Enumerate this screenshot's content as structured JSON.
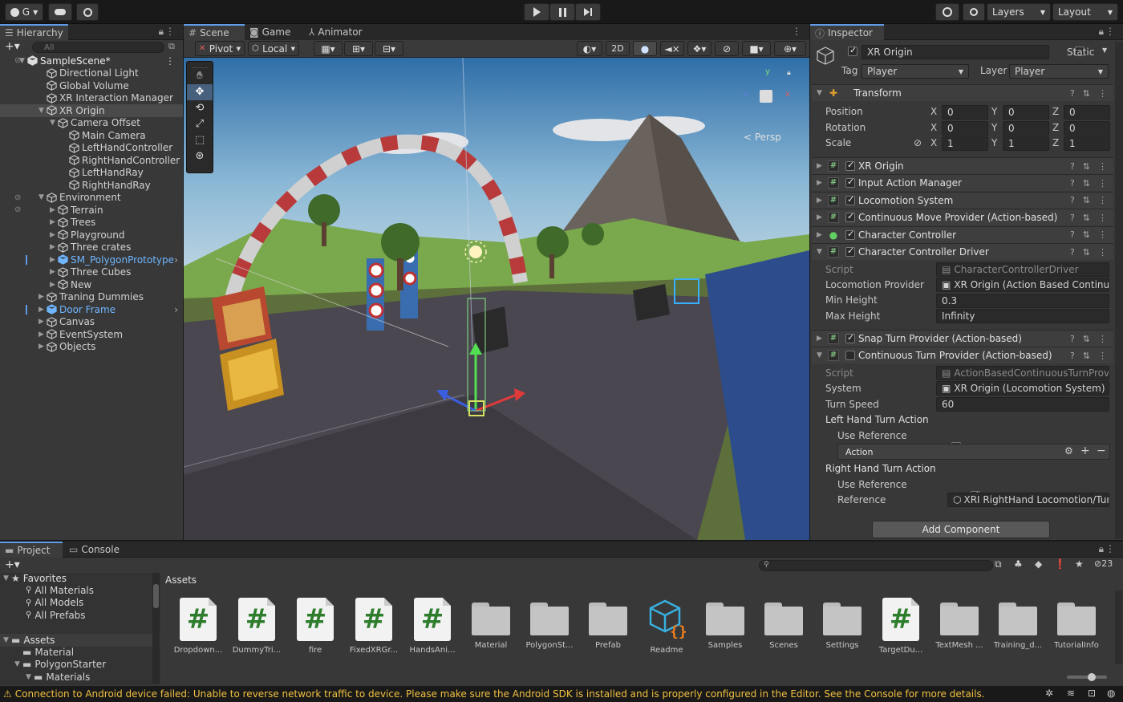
{
  "toolbar": {
    "account": "G",
    "layers_label": "Layers",
    "layout_label": "Layout"
  },
  "hierarchy": {
    "tab": "Hierarchy",
    "search_placeholder": "All",
    "items": [
      {
        "label": "SampleScene*",
        "depth": 0
      },
      {
        "label": "Directional Light",
        "depth": 1
      },
      {
        "label": "Global Volume",
        "depth": 1
      },
      {
        "label": "XR Interaction Manager",
        "depth": 1
      },
      {
        "label": "XR Origin",
        "depth": 1
      },
      {
        "label": "Camera Offset",
        "depth": 2
      },
      {
        "label": "Main Camera",
        "depth": 3
      },
      {
        "label": "LeftHandController",
        "depth": 3
      },
      {
        "label": "RightHandController",
        "depth": 3
      },
      {
        "label": "LeftHandRay",
        "depth": 3
      },
      {
        "label": "RightHandRay",
        "depth": 3
      },
      {
        "label": "Environment",
        "depth": 1
      },
      {
        "label": "Terrain",
        "depth": 2
      },
      {
        "label": "Trees",
        "depth": 2
      },
      {
        "label": "Playground",
        "depth": 2
      },
      {
        "label": "Three crates",
        "depth": 2
      },
      {
        "label": "SM_PolygonPrototype",
        "depth": 2
      },
      {
        "label": "Three Cubes",
        "depth": 2
      },
      {
        "label": "New",
        "depth": 2
      },
      {
        "label": "Traning Dummies",
        "depth": 1
      },
      {
        "label": "Door Frame",
        "depth": 1
      },
      {
        "label": "Canvas",
        "depth": 1
      },
      {
        "label": "EventSystem",
        "depth": 1
      },
      {
        "label": "Objects",
        "depth": 1
      }
    ]
  },
  "scene": {
    "tabs": [
      "Scene",
      "Game",
      "Animator"
    ],
    "pivot": "Pivot",
    "local": "Local",
    "mode_2d": "2D",
    "persp": "< Persp",
    "gizmo_x": "x",
    "gizmo_y": "y",
    "gizmo_z": "z"
  },
  "inspector": {
    "tab": "Inspector",
    "object_name": "XR Origin",
    "static_label": "Static",
    "tag_label": "Tag",
    "tag_value": "Player",
    "layer_label": "Layer",
    "layer_value": "Player",
    "transform": {
      "title": "Transform",
      "rows": [
        {
          "label": "Position",
          "x": "0",
          "y": "0",
          "z": "0"
        },
        {
          "label": "Rotation",
          "x": "0",
          "y": "0",
          "z": "0"
        },
        {
          "label": "Scale",
          "x": "1",
          "y": "1",
          "z": "1"
        }
      ],
      "axis_x": "X",
      "axis_y": "Y",
      "axis_z": "Z"
    },
    "components": [
      "XR Origin",
      "Input Action Manager",
      "Locomotion System",
      "Continuous Move Provider (Action-based)",
      "Character Controller",
      "Character Controller Driver"
    ],
    "ccd": {
      "script_label": "Script",
      "script_value": "CharacterControllerDriver",
      "locomotion_label": "Locomotion Provider",
      "locomotion_value": "XR Origin  (Action Based Continu",
      "min_label": "Min Height",
      "min_value": "0.3",
      "max_label": "Max Height",
      "max_value": "Infinity"
    },
    "snap": "Snap Turn Provider (Action-based)",
    "cont_turn": "Continuous Turn Provider (Action-based)",
    "ctp": {
      "script_label": "Script",
      "script_value": "ActionBasedContinuousTurnProv",
      "system_label": "System",
      "system_value": "XR Origin  (Locomotion System)",
      "speed_label": "Turn Speed",
      "speed_value": "60",
      "left_label": "Left Hand Turn Action",
      "use_ref_label": "Use Reference",
      "action_label": "Action",
      "right_label": "Right Hand Turn Action",
      "use_ref2_label": "Use Reference",
      "reference_label": "Reference",
      "reference_value": "XRI RightHand Locomotion/Tur"
    },
    "add_component": "Add Component"
  },
  "project": {
    "tabs": [
      "Project",
      "Console"
    ],
    "hidden_count": "23",
    "favorites_label": "Favorites",
    "favorites": [
      "All Materials",
      "All Models",
      "All Prefabs"
    ],
    "assets_label": "Assets",
    "assets_tree": [
      "Material",
      "PolygonStarter",
      "Materials"
    ],
    "breadcrumb": "Assets",
    "assets": [
      {
        "name": "Dropdown...",
        "type": "script"
      },
      {
        "name": "DummyTri...",
        "type": "script"
      },
      {
        "name": "fire",
        "type": "script"
      },
      {
        "name": "FixedXRGr...",
        "type": "script"
      },
      {
        "name": "HandsAni...",
        "type": "script"
      },
      {
        "name": "Material",
        "type": "folder"
      },
      {
        "name": "PolygonSt...",
        "type": "folder"
      },
      {
        "name": "Prefab",
        "type": "folder"
      },
      {
        "name": "Readme",
        "type": "readme"
      },
      {
        "name": "Samples",
        "type": "folder"
      },
      {
        "name": "Scenes",
        "type": "folder"
      },
      {
        "name": "Settings",
        "type": "folder"
      },
      {
        "name": "TargetDu...",
        "type": "script"
      },
      {
        "name": "TextMesh ...",
        "type": "folder"
      },
      {
        "name": "Training_d...",
        "type": "folder"
      },
      {
        "name": "TutorialInfo",
        "type": "folder"
      }
    ]
  },
  "status": {
    "message": "Connection to Android device failed: Unable to reverse network traffic to device. Please make sure the Android SDK is installed and is properly configured in the Editor. See the Console for more details."
  },
  "colors": {
    "accent": "#5f9be6",
    "warning": "#f0c040",
    "prefab_blue": "#6fb6ff"
  }
}
